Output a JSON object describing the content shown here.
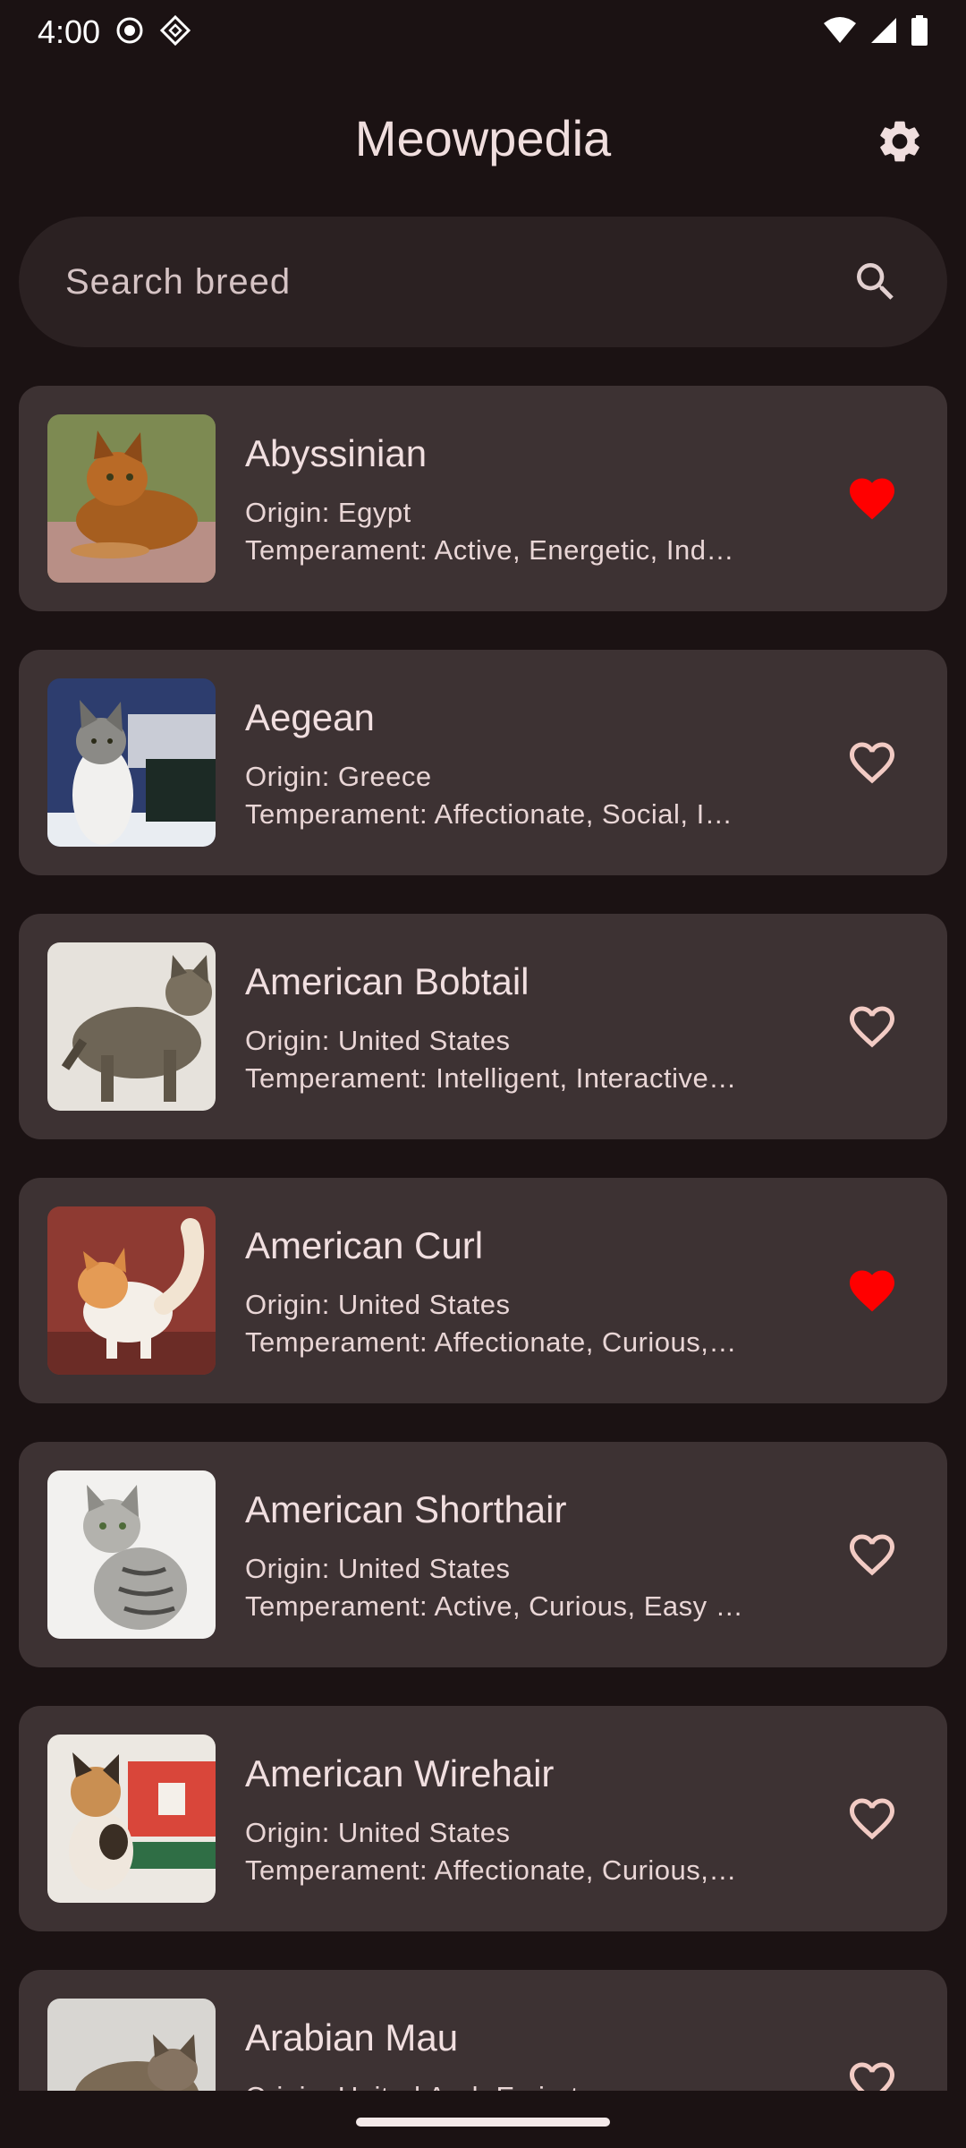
{
  "status_bar": {
    "time": "4:00",
    "icons": [
      "record-icon",
      "diamond-icon",
      "wifi-icon",
      "signal-icon",
      "battery-icon"
    ]
  },
  "app_bar": {
    "title": "Meowpedia",
    "settings_icon": "gear-icon"
  },
  "search": {
    "placeholder": "Search breed",
    "icon": "search-icon"
  },
  "colors": {
    "background": "#1b1213",
    "card": "#3d3233",
    "favorite": "#ff0000",
    "heart_outline": "#f2cbc4"
  },
  "breeds": [
    {
      "name": "Abyssinian",
      "origin": "Origin: Egypt",
      "temperament": "Temperament: Active, Energetic, Ind…",
      "favorite": true
    },
    {
      "name": "Aegean",
      "origin": "Origin: Greece",
      "temperament": "Temperament: Affectionate, Social, I…",
      "favorite": false
    },
    {
      "name": "American Bobtail",
      "origin": "Origin: United States",
      "temperament": "Temperament: Intelligent, Interactive…",
      "favorite": false
    },
    {
      "name": "American Curl",
      "origin": "Origin: United States",
      "temperament": "Temperament: Affectionate, Curious,…",
      "favorite": true
    },
    {
      "name": "American Shorthair",
      "origin": "Origin: United States",
      "temperament": "Temperament: Active, Curious, Easy …",
      "favorite": false
    },
    {
      "name": "American Wirehair",
      "origin": "Origin: United States",
      "temperament": "Temperament: Affectionate, Curious,…",
      "favorite": false
    },
    {
      "name": "Arabian Mau",
      "origin": "Origin: United Arab Emirates",
      "temperament": "",
      "favorite": false
    }
  ]
}
